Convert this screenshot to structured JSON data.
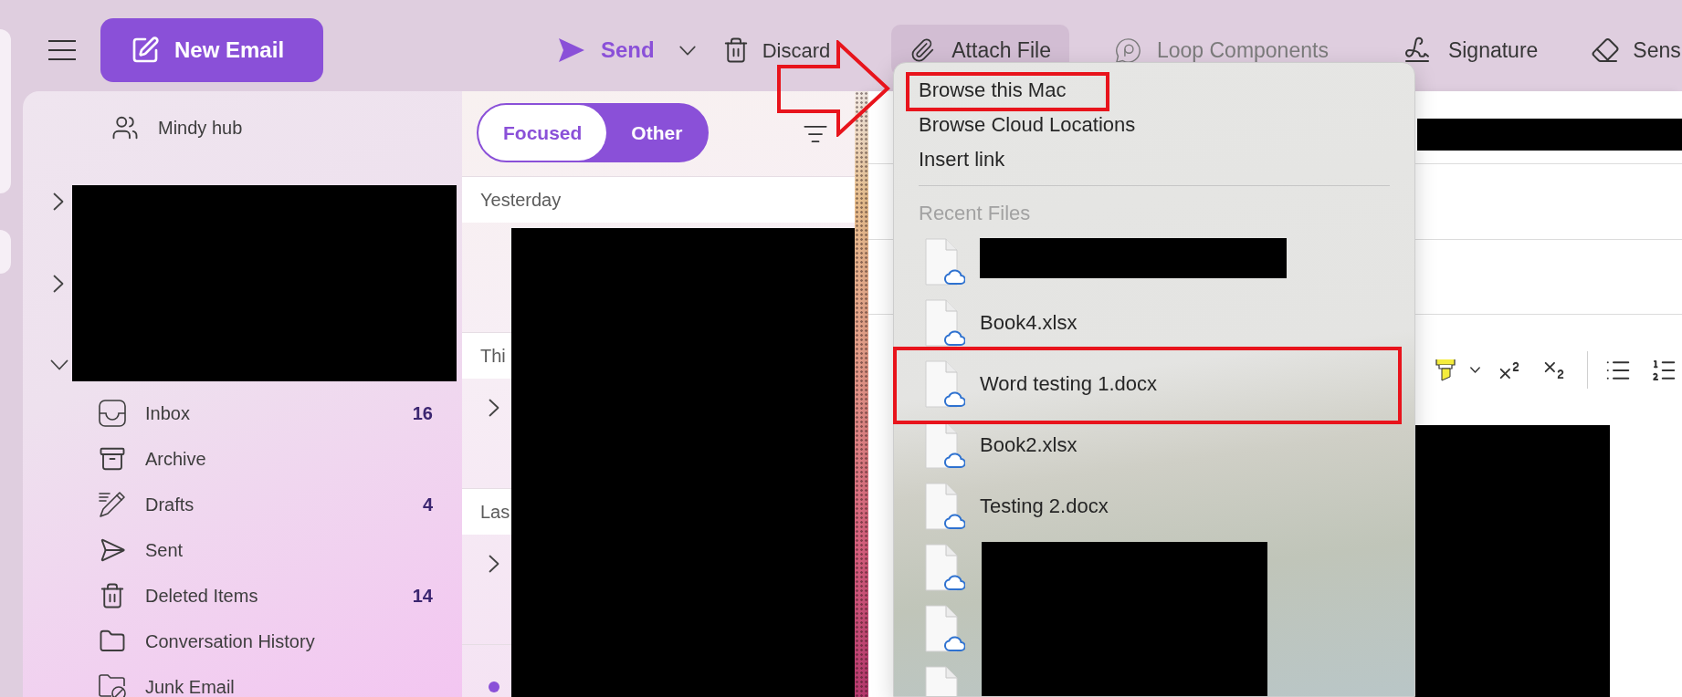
{
  "toolbar": {
    "new_email": {
      "label": "New Email"
    },
    "actions": [
      {
        "kind": "send",
        "label": "Send",
        "disabled": false,
        "expanded": false
      },
      {
        "kind": "discard",
        "label": "Discard",
        "disabled": false,
        "expanded": false
      },
      {
        "kind": "attach",
        "label": "Attach File",
        "disabled": false,
        "expanded": true
      },
      {
        "kind": "loop",
        "label": "Loop Components",
        "disabled": true,
        "expanded": false
      },
      {
        "kind": "signature",
        "label": "Signature",
        "disabled": false,
        "expanded": false
      },
      {
        "kind": "sensitivity",
        "label": "Sens",
        "disabled": false,
        "expanded": false
      }
    ]
  },
  "sidebar": {
    "pinned": [
      {
        "kind": "group",
        "label": "Mindy hub"
      }
    ],
    "accounts": [
      {
        "expanded": false
      },
      {
        "expanded": false
      },
      {
        "expanded": true,
        "folders": [
          {
            "kind": "inbox",
            "label": "Inbox",
            "count": "16"
          },
          {
            "kind": "archive",
            "label": "Archive"
          },
          {
            "kind": "drafts",
            "label": "Drafts",
            "count": "4"
          },
          {
            "kind": "sent",
            "label": "Sent"
          },
          {
            "kind": "deleted",
            "label": "Deleted Items",
            "count": "14"
          },
          {
            "kind": "folder",
            "label": "Conversation History"
          },
          {
            "kind": "junk",
            "label": "Junk Email"
          }
        ]
      }
    ]
  },
  "message_list": {
    "tabs": [
      {
        "label": "Focused",
        "selected": true
      },
      {
        "label": "Other",
        "selected": false
      }
    ],
    "sections": [
      {
        "header": "Yesterday",
        "rows": [
          {
            "kind": "message",
            "unread": false
          }
        ]
      },
      {
        "header": "Thi",
        "rows": [
          {
            "kind": "thread",
            "expanded": false
          }
        ]
      },
      {
        "header": "Las",
        "rows": [
          {
            "kind": "thread",
            "expanded": false
          },
          {
            "kind": "message",
            "unread": true
          }
        ]
      }
    ]
  },
  "attach_menu": {
    "items": [
      {
        "label": "Browse this Mac"
      },
      {
        "label": "Browse Cloud Locations"
      },
      {
        "label": "Insert link"
      }
    ],
    "recent_header": "Recent Files",
    "recent_files": [
      {
        "kind": "redacted"
      },
      {
        "kind": "file",
        "name": "Book4.xlsx"
      },
      {
        "kind": "file",
        "name": "Word testing 1.docx"
      },
      {
        "kind": "file",
        "name": "Book2.xlsx"
      },
      {
        "kind": "file",
        "name": "Testing 2.docx"
      },
      {
        "kind": "redacted"
      },
      {
        "kind": "redacted"
      },
      {
        "kind": "redacted"
      }
    ]
  }
}
